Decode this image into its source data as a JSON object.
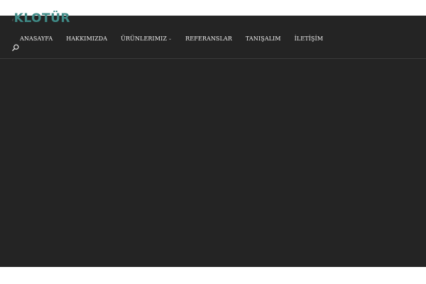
{
  "logo": {
    "text": "KLOTÜR",
    "color": "#3f8a86"
  },
  "nav": {
    "items": [
      {
        "label": "ANASAYFA"
      },
      {
        "label": "HAKKIMIZDA"
      },
      {
        "label": "ÜRÜNLERIMIZ",
        "has_dropdown": true,
        "dropdown_icon": "chevron-down-icon"
      },
      {
        "label": "REFERANSLAR"
      },
      {
        "label": "TANIŞALIM"
      },
      {
        "label": "İLETİŞİM"
      }
    ]
  },
  "header": {
    "search_icon": "search-icon"
  },
  "colors": {
    "background": "#242424",
    "page_background": "#ffffff",
    "nav_text": "#f2f2f2",
    "divider": "#3a3a3a"
  }
}
